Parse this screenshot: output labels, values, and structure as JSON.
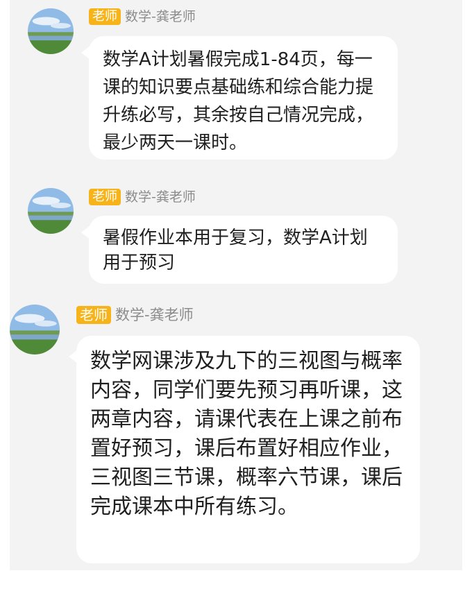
{
  "messages": [
    {
      "role_badge": "老师",
      "sender": "数学-龚老师",
      "text": "数学A计划暑假完成1-84页，每一课的知识要点基础练和综合能力提升练必写，其余按自己情况完成，最少两天一课时。"
    },
    {
      "role_badge": "老师",
      "sender": "数学-龚老师",
      "text": "暑假作业本用于复习，数学A计划用于预习"
    },
    {
      "role_badge": "老师",
      "sender": "数学-龚老师",
      "text": "数学网课涉及九下的三视图与概率内容，同学们要先预习再听课，这两章内容，请课代表在上课之前布置好预习，课后布置好相应作业，三视图三节课，概率六节课，课后完成课本中所有练习。"
    }
  ],
  "colors": {
    "badge": "#f7b31a",
    "bubble": "#ffffff",
    "background": "#f3f3f4",
    "sender_name": "#8c8c8c"
  },
  "icons": [
    "avatar-landscape-icon"
  ]
}
